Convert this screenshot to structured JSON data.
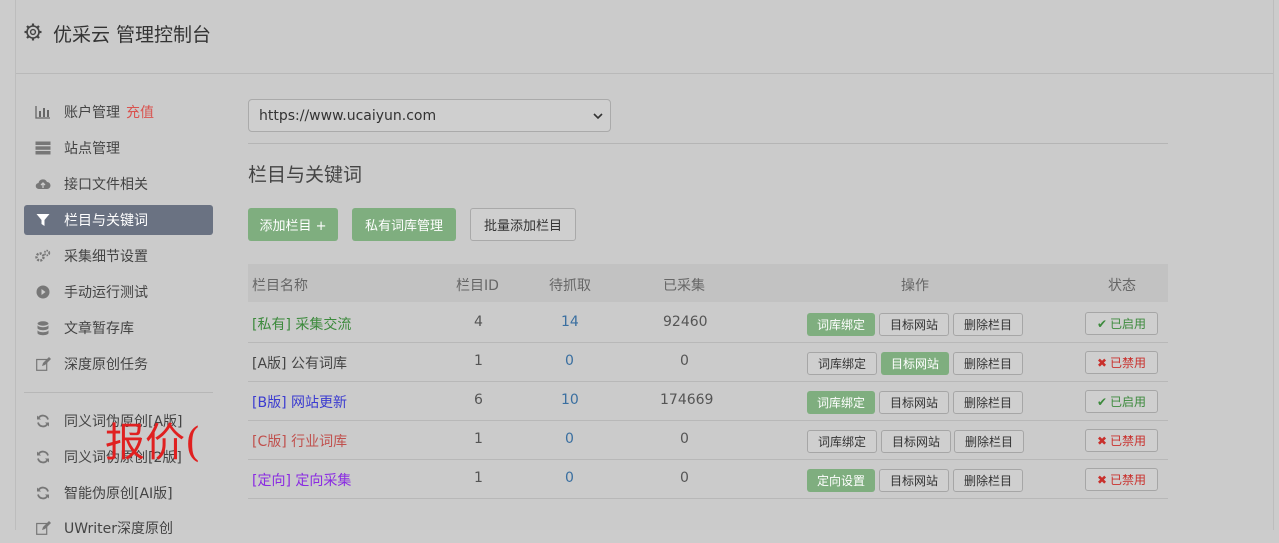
{
  "app": {
    "title": "优采云 管理控制台"
  },
  "sidebar": {
    "items": [
      {
        "label": "账户管理",
        "extra": "充值",
        "icon": "bar-chart-icon"
      },
      {
        "label": "站点管理",
        "icon": "server-icon"
      },
      {
        "label": "接口文件相关",
        "icon": "cloud-upload-icon"
      },
      {
        "label": "栏目与关键词",
        "icon": "filter-icon",
        "active": true
      },
      {
        "label": "采集细节设置",
        "icon": "gears-icon"
      },
      {
        "label": "手动运行测试",
        "icon": "play-circle-icon"
      },
      {
        "label": "文章暂存库",
        "icon": "database-icon"
      },
      {
        "label": "深度原创任务",
        "icon": "edit-icon"
      },
      {
        "label": "同义词伪原创[A版]",
        "icon": "refresh-icon"
      },
      {
        "label": "同义词伪原创[2版]",
        "icon": "refresh-icon"
      },
      {
        "label": "智能伪原创[AI版]",
        "icon": "refresh-icon"
      },
      {
        "label": "UWriter深度原创",
        "icon": "edit-icon"
      }
    ],
    "overlay_text": "报价("
  },
  "main": {
    "site_select": {
      "value": "https://www.ucaiyun.com"
    },
    "page_title": "栏目与关键词",
    "buttons": {
      "add_column": "添加栏目 +",
      "private_lexicon": "私有词库管理",
      "batch_add": "批量添加栏目"
    },
    "table": {
      "headers": [
        "栏目名称",
        "栏目ID",
        "待抓取",
        "已采集",
        "操作",
        "状态"
      ],
      "rows": [
        {
          "tag": "[私有]",
          "name": "采集交流",
          "id": "4",
          "pending": "14",
          "collected": "92460",
          "op1": "词库绑定",
          "op2": "目标网站",
          "op3": "删除栏目",
          "status": "已启用"
        },
        {
          "tag": "[A版]",
          "name": "公有词库",
          "id": "1",
          "pending": "0",
          "collected": "0",
          "op1": "词库绑定",
          "op2": "目标网站",
          "op3": "删除栏目",
          "status": "已禁用"
        },
        {
          "tag": "[B版]",
          "name": "网站更新",
          "id": "6",
          "pending": "10",
          "collected": "174669",
          "op1": "词库绑定",
          "op2": "目标网站",
          "op3": "删除栏目",
          "status": "已启用"
        },
        {
          "tag": "[C版]",
          "name": "行业词库",
          "id": "1",
          "pending": "0",
          "collected": "0",
          "op1": "词库绑定",
          "op2": "目标网站",
          "op3": "删除栏目",
          "status": "已禁用"
        },
        {
          "tag": "[定向]",
          "name": "定向采集",
          "id": "1",
          "pending": "0",
          "collected": "0",
          "op1": "定向设置",
          "op2": "目标网站",
          "op3": "删除栏目",
          "status": "已禁用"
        }
      ]
    }
  },
  "colors": {
    "tag_private": "#3c8a3c",
    "tag_a": "#444444",
    "tag_b": "#3b3bd0",
    "tag_c": "#c0504d",
    "tag_directed": "#8a2be2",
    "accent_green": "#7fae7f",
    "active_nav": "#6a7282"
  }
}
